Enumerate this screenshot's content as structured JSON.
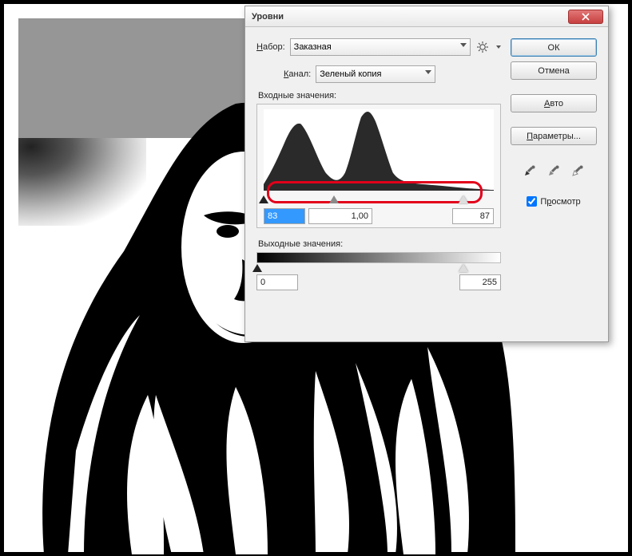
{
  "dialog": {
    "title": "Уровни",
    "preset_label": "Набор:",
    "preset_value": "Заказная",
    "channel_label": "Канал:",
    "channel_value": "Зеленый копия",
    "input_label": "Входные значения:",
    "output_label": "Выходные значения:",
    "input_black": "83",
    "input_gamma": "1,00",
    "input_white": "87",
    "output_black": "0",
    "output_white": "255"
  },
  "buttons": {
    "ok": "ОК",
    "cancel": "Отмена",
    "auto": "Авто",
    "options": "Параметры..."
  },
  "preview": {
    "label": "Просмотр",
    "checked": true
  },
  "icons": {
    "close": "close-icon",
    "gear": "gear-icon",
    "eyedrop_black": "eyedropper-black-icon",
    "eyedrop_gray": "eyedropper-gray-icon",
    "eyedrop_white": "eyedropper-white-icon"
  }
}
